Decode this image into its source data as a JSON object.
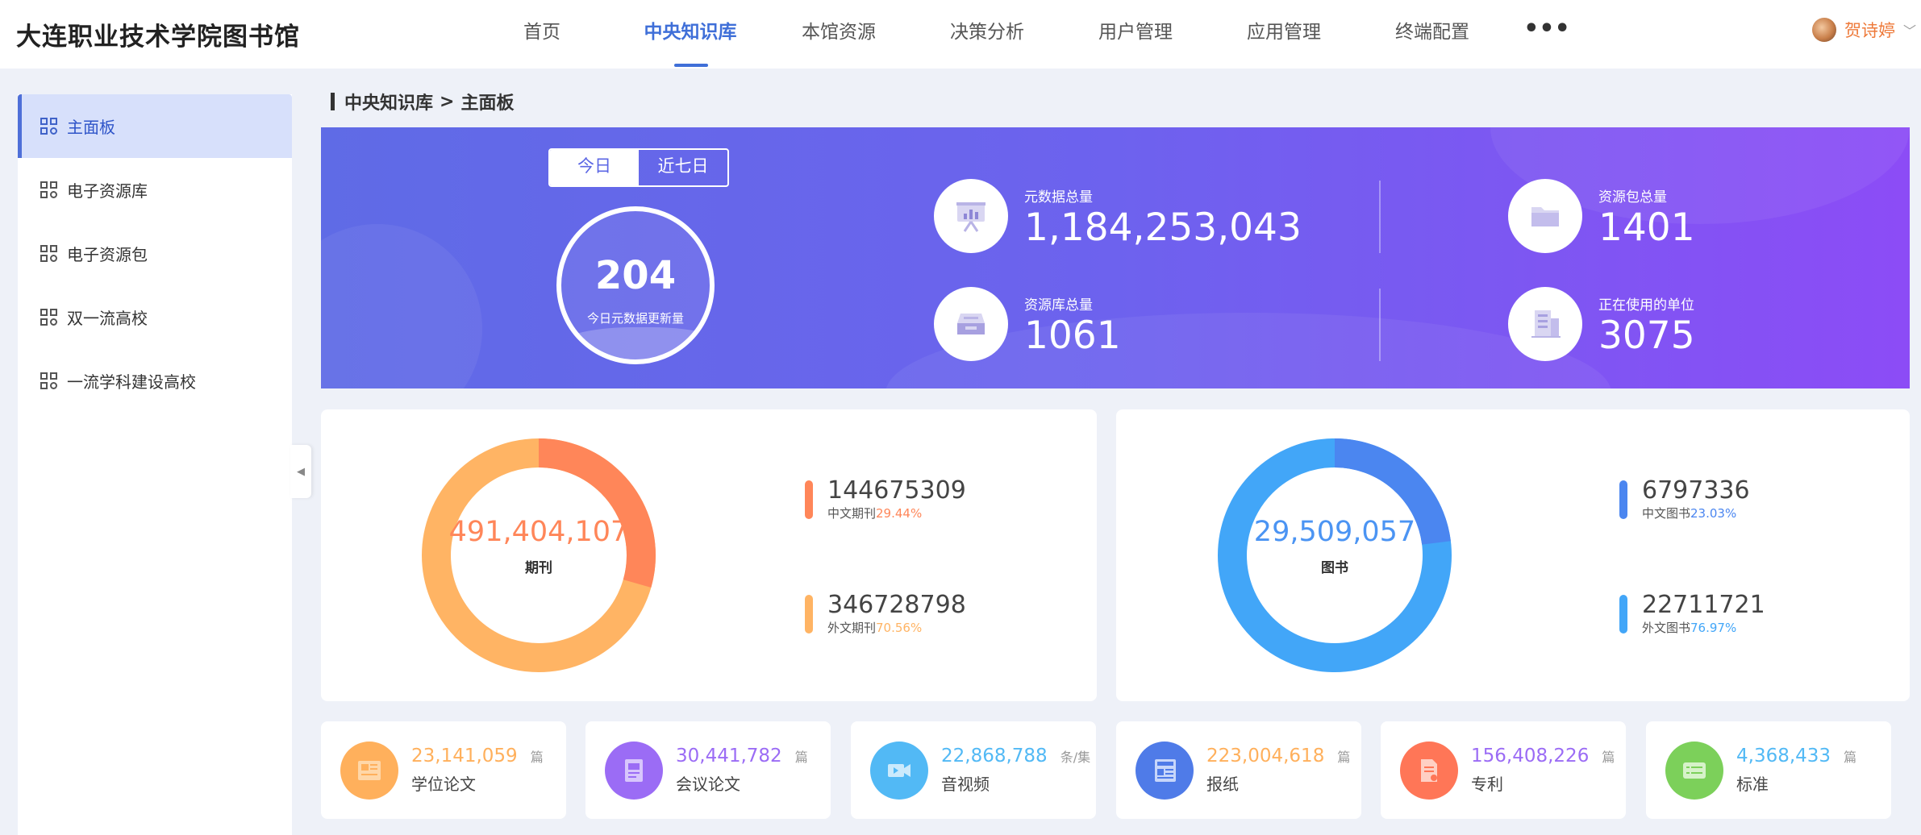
{
  "app": {
    "title": "大连职业技术学院图书馆"
  },
  "nav": {
    "items": [
      "首页",
      "中央知识库",
      "本馆资源",
      "决策分析",
      "用户管理",
      "应用管理",
      "终端配置"
    ],
    "active": "中央知识库",
    "more": "•••"
  },
  "user": {
    "name": "贺诗婷",
    "chevron": "﹀"
  },
  "sidebar": {
    "items": [
      {
        "label": "主面板",
        "active": true
      },
      {
        "label": "电子资源库"
      },
      {
        "label": "电子资源包"
      },
      {
        "label": "双一流高校"
      },
      {
        "label": "一流学科建设高校"
      }
    ],
    "collapse_icon": "◀"
  },
  "breadcrumb": {
    "section": "中央知识库",
    "sep": ">",
    "page": "主面板"
  },
  "banner": {
    "toggle": {
      "today": "今日",
      "week": "近七日"
    },
    "today_count": {
      "value": "204",
      "label": "今日元数据更新量"
    },
    "stats": [
      {
        "label": "元数据总量",
        "value": "1,184,253,043",
        "icon": "presentation-chart-icon"
      },
      {
        "label": "资源包总量",
        "value": "1401",
        "icon": "folder-icon"
      },
      {
        "label": "资源库总量",
        "value": "1061",
        "icon": "inbox-tray-icon"
      },
      {
        "label": "正在使用的单位",
        "value": "3075",
        "icon": "building-icon"
      }
    ]
  },
  "journals": {
    "total": "491,404,107",
    "label": "期刊",
    "colors": {
      "primary": "#ff8659",
      "secondary": "#ffb464"
    },
    "items": [
      {
        "value": "144675309",
        "label": "中文期刊",
        "pct": "29.44%",
        "fraction": 0.2944
      },
      {
        "value": "346728798",
        "label": "外文期刊",
        "pct": "70.56%",
        "fraction": 0.7056
      }
    ]
  },
  "books": {
    "total": "29,509,057",
    "label": "图书",
    "colors": {
      "primary": "#4b86f0",
      "secondary": "#42a6f8"
    },
    "items": [
      {
        "value": "6797336",
        "label": "中文图书",
        "pct": "23.03%",
        "fraction": 0.2303
      },
      {
        "value": "22711721",
        "label": "外文图书",
        "pct": "76.97%",
        "fraction": 0.7697
      }
    ]
  },
  "resources": [
    {
      "value": "23,141,059",
      "unit": "篇",
      "label": "学位论文",
      "color": "#ffb05c",
      "icon": "newspaper-icon"
    },
    {
      "value": "30,441,782",
      "unit": "篇",
      "label": "会议论文",
      "color": "#9b6cf5",
      "icon": "document-icon"
    },
    {
      "value": "22,868,788",
      "unit": "条/集",
      "label": "音视频",
      "color": "#52b9f5",
      "icon": "video-camera-icon"
    },
    {
      "value": "223,004,618",
      "unit": "篇",
      "label": "报纸",
      "color": "#ffb05c",
      "icon": "news-icon",
      "iconBg": "#4f7be8"
    },
    {
      "value": "156,408,226",
      "unit": "篇",
      "label": "专利",
      "color": "#9b6cf5",
      "icon": "patent-file-icon",
      "iconBg": "#ff7657"
    },
    {
      "value": "4,368,433",
      "unit": "篇",
      "label": "标准",
      "color": "#52b9f5",
      "icon": "id-card-icon",
      "iconBg": "#7cd05a"
    }
  ]
}
